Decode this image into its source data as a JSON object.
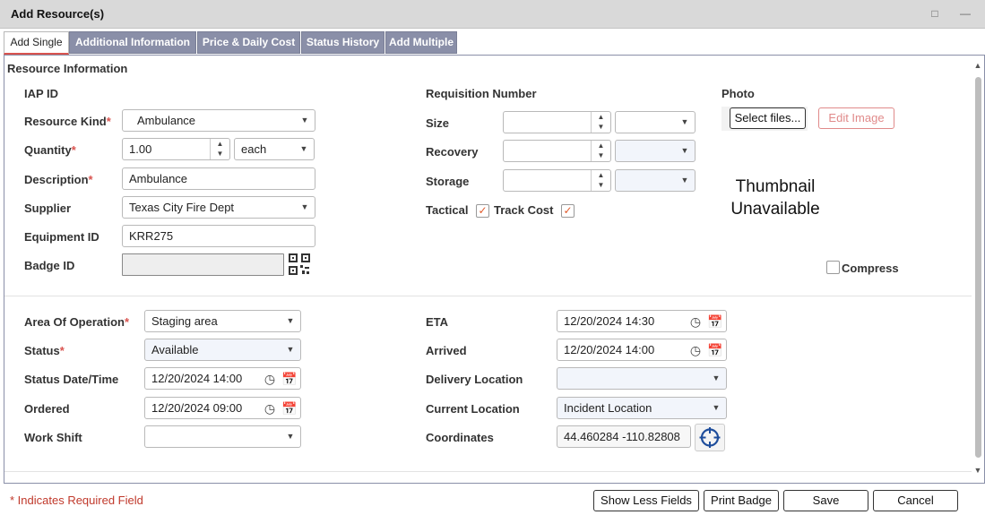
{
  "window": {
    "title": "Add Resource(s)"
  },
  "tabs": [
    "Add Single",
    "Additional Information",
    "Price & Daily Cost",
    "Status History",
    "Add Multiple"
  ],
  "section": {
    "title": "Resource Information"
  },
  "left": {
    "iap_id_label": "IAP ID",
    "resource_kind_label": "Resource Kind",
    "resource_kind_value": "Ambulance",
    "quantity_label": "Quantity",
    "quantity_value": "1.00",
    "quantity_unit": "each",
    "description_label": "Description",
    "description_value": "Ambulance",
    "supplier_label": "Supplier",
    "supplier_value": "Texas City Fire Dept",
    "equipment_id_label": "Equipment ID",
    "equipment_id_value": "KRR275",
    "badge_id_label": "Badge ID",
    "badge_id_value": ""
  },
  "middle": {
    "requisition_label": "Requisition Number",
    "size_label": "Size",
    "recovery_label": "Recovery",
    "storage_label": "Storage",
    "tactical_label": "Tactical",
    "track_cost_label": "Track Cost",
    "tactical_checked": true,
    "track_cost_checked": true
  },
  "photo": {
    "label": "Photo",
    "select_files": "Select files...",
    "edit_image": "Edit Image",
    "thumbnail_line1": "Thumbnail",
    "thumbnail_line2": "Unavailable",
    "compress_label": "Compress",
    "compress_checked": false
  },
  "lower_left": {
    "area_label": "Area Of Operation",
    "area_value": "Staging area",
    "status_label": "Status",
    "status_value": "Available",
    "status_dt_label": "Status Date/Time",
    "status_dt_value": "12/20/2024 14:00",
    "ordered_label": "Ordered",
    "ordered_value": "12/20/2024 09:00",
    "work_shift_label": "Work Shift",
    "work_shift_value": ""
  },
  "lower_right": {
    "eta_label": "ETA",
    "eta_value": "12/20/2024 14:30",
    "arrived_label": "Arrived",
    "arrived_value": "12/20/2024 14:00",
    "delivery_label": "Delivery Location",
    "delivery_value": "",
    "current_label": "Current Location",
    "current_value": "Incident Location",
    "coords_label": "Coordinates",
    "coords_value": "44.460284 -110.82808"
  },
  "required_marker": "*",
  "footer": {
    "note": "* Indicates Required Field",
    "show_less": "Show Less Fields",
    "print_badge": "Print Badge",
    "save": "Save",
    "cancel": "Cancel"
  },
  "colors": {
    "tab_inactive": "#8a8fa8",
    "required": "#d9534f",
    "check": "#e05a2b"
  }
}
